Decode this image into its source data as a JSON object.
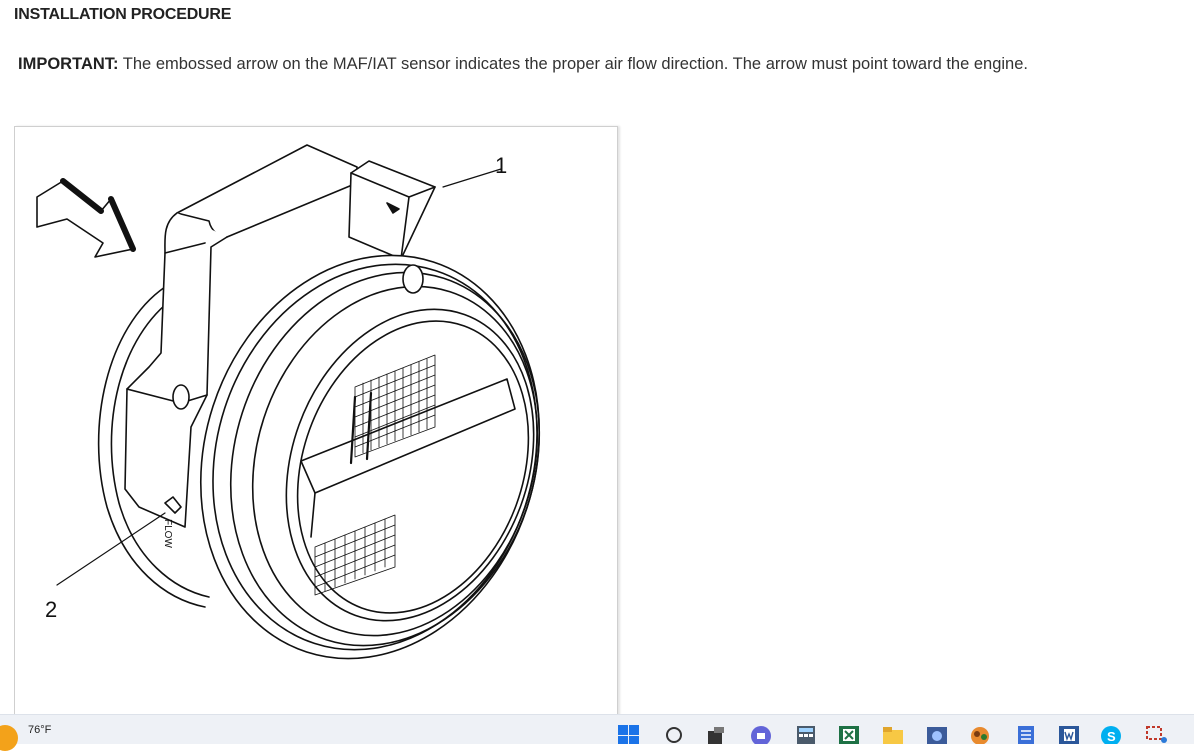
{
  "procedure": {
    "heading": "INSTALLATION PROCEDURE",
    "important_label": "IMPORTANT:",
    "important_text": " The embossed arrow on the MAF/IAT sensor indicates the proper air flow direction. The arrow must point toward the engine."
  },
  "figure": {
    "callout_1": "1",
    "callout_2": "2",
    "flow_label": "FLOW"
  },
  "taskbar": {
    "temperature": "76°F",
    "icons": [
      "weather-sun-icon",
      "windows-start-icon",
      "search-icon",
      "task-view-icon",
      "teams-chat-icon",
      "calculator-icon",
      "excel-icon",
      "file-explorer-icon",
      "media-player-icon",
      "game-icon",
      "notepad-icon",
      "word-icon",
      "skype-icon",
      "snipping-tool-icon"
    ]
  }
}
